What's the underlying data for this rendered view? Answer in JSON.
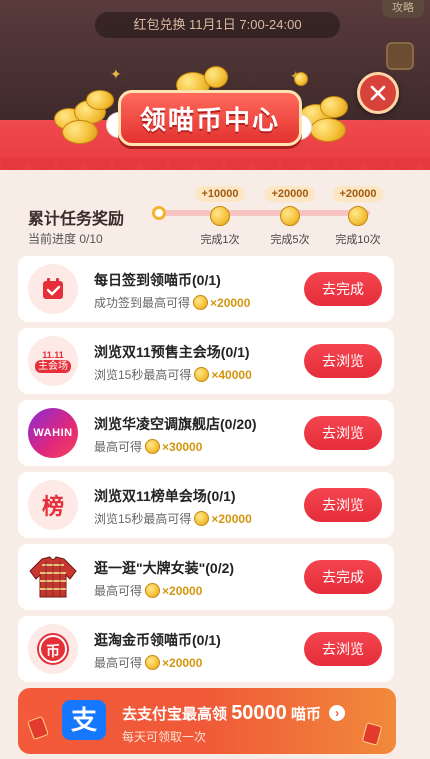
{
  "background": {
    "redeem_time": "红包兑换 11月1日 7:00-24:00",
    "corner_button": "攻略"
  },
  "modal": {
    "title": "领喵币中心",
    "close_icon": "close-icon"
  },
  "progress": {
    "title": "累计任务奖励",
    "current": "当前进度 0/10",
    "milestones": [
      {
        "reward": "+10000",
        "label": "完成1次"
      },
      {
        "reward": "+20000",
        "label": "完成5次"
      },
      {
        "reward": "+20000",
        "label": "完成10次"
      }
    ]
  },
  "tasks": [
    {
      "title": "每日签到领喵币(0/1)",
      "desc": "成功签到最高可得",
      "amount": "×20000",
      "button": "去完成",
      "icon": "calendar-check-icon"
    },
    {
      "title": "浏览双11预售主会场(0/1)",
      "desc": "浏览15秒最高可得",
      "amount": "×40000",
      "button": "去浏览",
      "icon": "main-venue-icon",
      "icon_text": "主会场"
    },
    {
      "title": "浏览华凌空调旗舰店(0/20)",
      "desc": "最高可得",
      "amount": "×30000",
      "button": "去浏览",
      "icon": "wahin-logo-icon",
      "icon_text": "WAHIN"
    },
    {
      "title": "浏览双11榜单会场(0/1)",
      "desc": "浏览15秒最高可得",
      "amount": "×20000",
      "button": "去浏览",
      "icon": "ranking-icon",
      "icon_text": "榜"
    },
    {
      "title": "逛一逛\"大牌女装\"(0/2)",
      "desc": "最高可得",
      "amount": "×20000",
      "button": "去完成",
      "icon": "sweater-icon"
    },
    {
      "title": "逛淘金币领喵币(0/1)",
      "desc": "最高可得",
      "amount": "×20000",
      "button": "去浏览",
      "icon": "gold-coin-icon",
      "icon_text": "币"
    }
  ],
  "alipay_banner": {
    "title_prefix": "去支付宝最高领",
    "title_amount": "50000",
    "title_suffix": "喵币",
    "subtitle": "每天可领取一次",
    "logo_text": "支"
  },
  "colors": {
    "accent_red": "#e52d3a",
    "coin_gold": "#f5c13a",
    "panel_bg": "#f7ece6"
  }
}
